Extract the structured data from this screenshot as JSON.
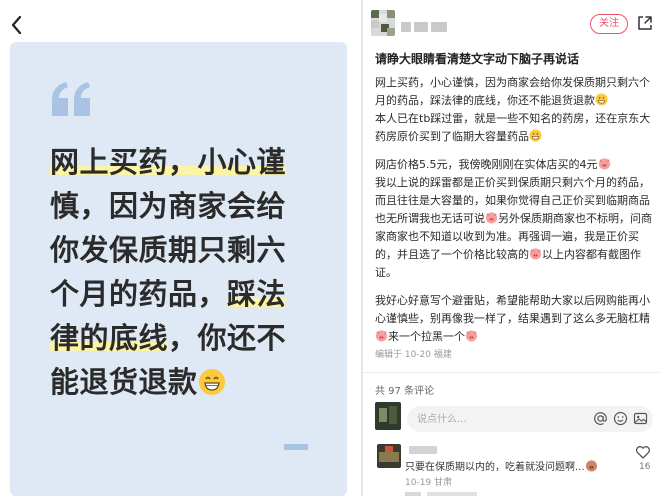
{
  "left_card": {
    "line1": "网上买药，小心谨",
    "line2": "慎，因为商家会给",
    "line3": "你发保质期只剩六",
    "line4a": "个月的药品，",
    "line4b": "踩法",
    "line5a": "律的底线",
    "line5b": "，你还不",
    "line6": "能退货退款"
  },
  "header": {
    "follow_label": "关注"
  },
  "post": {
    "title": "请睁大眼睛看清楚文字动下脑子再说话",
    "p1": "网上买药，小心谨慎，因为商家会给你发保质期只剩六个月的药品，踩法律的底线，你还不能退货退款",
    "p2": "本人已在tb踩过雷，就是一些不知名的药房，还在京东大药房原价买到了临期大容量药品",
    "p3a": "网店价格5.5元，我傍晚刚刚在实体店买的4元",
    "p3b": "我以上说的踩雷都是正价买到保质期只剩六个月的药品，而且往往是大容量的，如果你觉得自己正价买到临期商品也无所谓我也无话可说",
    "p3c": "另外保质期商家也不标明，问商家商家也不知道以收到为准。再强调一遍，我是正价买的，并且选了一个价格比较高的",
    "p3d": "以上内容都有截图作证。",
    "p4a": "我好心好意写个避雷贴，希望能帮助大家以后网购能再小心谨慎些，别再像我一样了，结果遇到了这么多无脑杠精",
    "p4b": "来一个拉黑一个",
    "date": "编辑于 10-20 福建"
  },
  "comments": {
    "count_label": "共 97 条评论",
    "input_placeholder": "说点什么...",
    "first_text": "只要在保质期以内的，吃着就没问题啊...",
    "first_date": "10-19 甘肃",
    "first_likes": "16"
  },
  "icons": {
    "back": "back-arrow-icon",
    "share": "share-icon",
    "quote": "quote-mark-icon",
    "grin": "grinning-emoji-icon",
    "pig": "pig-emoji-icon",
    "mention": "at-icon",
    "emoji": "emoji-icon",
    "image": "image-icon",
    "like": "heart-icon"
  },
  "colors": {
    "card_bg": "#dfe9f5",
    "highlight": "#fbf3a5",
    "accent": "#f0506a"
  }
}
